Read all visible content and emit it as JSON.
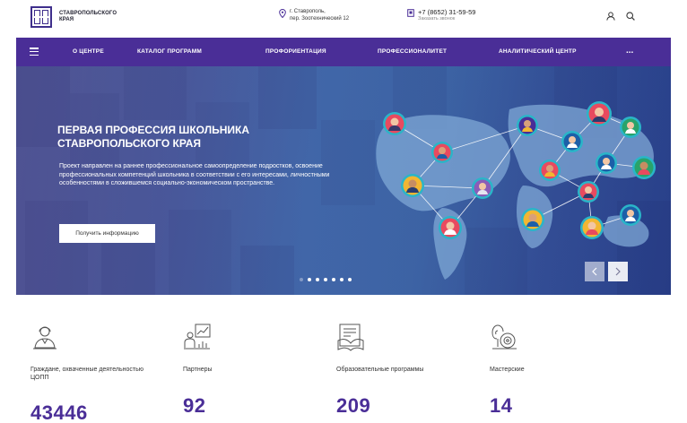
{
  "header": {
    "logo_line1": "СТАВРОПОЛЬСКОГО",
    "logo_line2": "КРАЯ",
    "location_line1": "г. Ставрополь,",
    "location_line2": "пер. Зоотехнический 12",
    "phone": "+7 (8652) 31-59-59",
    "callback": "Заказать звонок"
  },
  "nav": {
    "items": [
      {
        "label": "О ЦЕНТРЕ"
      },
      {
        "label": "КАТАЛОГ ПРОГРАММ"
      },
      {
        "label": "ПРОФОРИЕНТАЦИЯ"
      },
      {
        "label": "ПРОФЕССИОНАЛИТЕТ"
      },
      {
        "label": "АНАЛИТИЧЕСКИЙ ЦЕНТР"
      }
    ],
    "more": "..."
  },
  "hero": {
    "title_line1": "ПЕРВАЯ ПРОФЕССИЯ ШКОЛЬНИКА",
    "title_line2": "СТАВРОПОЛЬСКОГО КРАЯ",
    "description": "Проект направлен на раннее профессиональное самоопределение подростков, освоение профессиональных компетенций школьника в соответствии с его интересами, личностными особенностями в сложившемся социально-экономическом пространстве.",
    "button": "Получить информацию",
    "slides_total": 7,
    "active_slide": 2
  },
  "stats": [
    {
      "label": "Граждане, охваченные деятельностью ЦОПП",
      "value": "43446"
    },
    {
      "label": "Партнеры",
      "value": "92"
    },
    {
      "label": "Образовательные программы",
      "value": "209"
    },
    {
      "label": "Мастерские",
      "value": "14"
    }
  ],
  "colors": {
    "brand": "#4a2e97",
    "hero": "#3e72b2"
  },
  "icons": {
    "location": "location-pin-icon",
    "phone": "phone-icon",
    "user": "user-icon",
    "search": "search-icon",
    "menu": "hamburger-menu-icon",
    "prev": "chevron-left-icon",
    "next": "chevron-right-icon",
    "stat_citizens": "person-icon",
    "stat_partners": "partners-chart-icon",
    "stat_programs": "book-icon",
    "stat_workshops": "workshop-gear-icon"
  }
}
